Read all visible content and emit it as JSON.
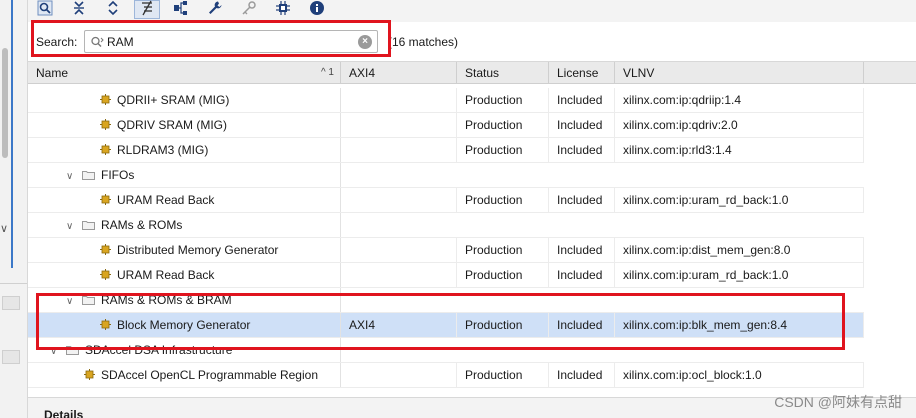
{
  "toolbar": {
    "buttons": [
      {
        "icon": "search-icon"
      },
      {
        "icon": "collapse-all-icon"
      },
      {
        "icon": "expand-all-icon"
      },
      {
        "icon": "hierarchy-icon"
      },
      {
        "icon": "network-icon"
      },
      {
        "icon": "wrench-icon"
      },
      {
        "icon": "key-icon"
      },
      {
        "icon": "chip-icon"
      },
      {
        "icon": "info-icon"
      }
    ]
  },
  "search": {
    "label": "Search:",
    "value": "RAM",
    "match_count": "(16 matches)"
  },
  "table": {
    "columns": {
      "name": "Name",
      "name_sort": "^ 1",
      "axi4": "AXI4",
      "status": "Status",
      "license": "License",
      "vlnv": "VLNV"
    },
    "rows": [
      {
        "type": "ip",
        "name": "QDRII+ SRAM (MIG)",
        "axi4": "",
        "status": "Production",
        "license": "Included",
        "vlnv": "xilinx.com:ip:qdriip:1.4"
      },
      {
        "type": "ip",
        "name": "QDRIV SRAM (MIG)",
        "axi4": "",
        "status": "Production",
        "license": "Included",
        "vlnv": "xilinx.com:ip:qdriv:2.0"
      },
      {
        "type": "ip",
        "name": "RLDRAM3 (MIG)",
        "axi4": "",
        "status": "Production",
        "license": "Included",
        "vlnv": "xilinx.com:ip:rld3:1.4"
      },
      {
        "type": "group",
        "name": "FIFOs"
      },
      {
        "type": "ip",
        "name": "URAM Read Back",
        "axi4": "",
        "status": "Production",
        "license": "Included",
        "vlnv": "xilinx.com:ip:uram_rd_back:1.0"
      },
      {
        "type": "group",
        "name": "RAMs & ROMs"
      },
      {
        "type": "ip",
        "name": "Distributed Memory Generator",
        "axi4": "",
        "status": "Production",
        "license": "Included",
        "vlnv": "xilinx.com:ip:dist_mem_gen:8.0"
      },
      {
        "type": "ip",
        "name": "URAM Read Back",
        "axi4": "",
        "status": "Production",
        "license": "Included",
        "vlnv": "xilinx.com:ip:uram_rd_back:1.0"
      },
      {
        "type": "group",
        "name": "RAMs & ROMs & BRAM"
      },
      {
        "type": "ip",
        "name": "Block Memory Generator",
        "axi4": "AXI4",
        "status": "Production",
        "license": "Included",
        "vlnv": "xilinx.com:ip:blk_mem_gen:8.4",
        "selected": true
      },
      {
        "type": "group",
        "name": "SDAccel DSA Infrastructure"
      },
      {
        "type": "ip",
        "name": "SDAccel OpenCL Programmable Region",
        "axi4": "",
        "status": "Production",
        "license": "Included",
        "vlnv": "xilinx.com:ip:ocl_block:1.0"
      }
    ]
  },
  "details": {
    "label": "Details"
  },
  "watermark": "CSDN @阿妹有点甜",
  "colors": {
    "highlight_box": "#e0141e",
    "selection": "#cfe0f7",
    "ip_icon": "#d9a520"
  }
}
